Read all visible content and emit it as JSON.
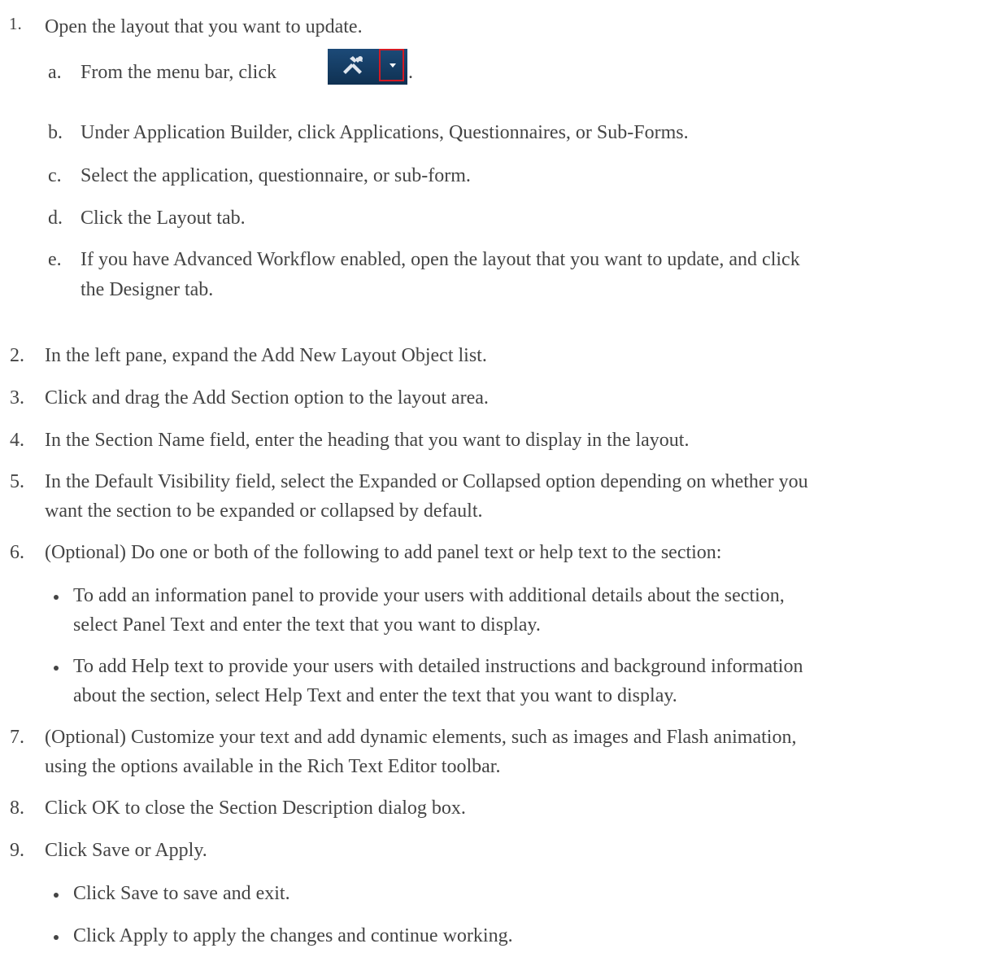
{
  "steps": {
    "s1": {
      "num": "1.",
      "text": "Open the layout that you want to update."
    },
    "s1a": {
      "letter": "a.",
      "text": "From the menu bar, click",
      "after": "."
    },
    "s1b": {
      "letter": "b.",
      "text": "Under Application Builder, click Applications, Questionnaires, or Sub-Forms."
    },
    "s1c": {
      "letter": "c.",
      "text": "Select the application, questionnaire, or sub-form."
    },
    "s1d": {
      "letter": "d.",
      "text": "Click the Layout tab."
    },
    "s1e": {
      "letter": "e.",
      "line1": "If you have Advanced Workflow enabled, open the layout that you want to update, and click",
      "line2": "the Designer tab."
    },
    "s2": {
      "num": "2.",
      "text": "In the left pane, expand the Add New Layout Object list."
    },
    "s3": {
      "num": "3.",
      "text": "Click and drag the Add Section option to the layout area."
    },
    "s4": {
      "num": "4.",
      "text": "In the Section Name field, enter the heading that you want to display in the layout."
    },
    "s5": {
      "num": "5.",
      "line1": "In the Default Visibility field, select the Expanded or Collapsed option depending on whether you",
      "line2": "want the section to be expanded or collapsed by default."
    },
    "s6": {
      "num": "6.",
      "text": "(Optional) Do one or both of the following to add panel text or help text to the section:"
    },
    "s6b1": {
      "line1": "To add an information panel to provide your users with additional details about the section,",
      "line2": "select Panel Text and enter the text that you want to display."
    },
    "s6b2": {
      "line1": "To add Help text to provide your users with detailed instructions and background information",
      "line2": "about the section, select Help Text and enter the text that you want to display."
    },
    "s7": {
      "num": "7.",
      "line1": "(Optional) Customize your text and add dynamic elements, such as images and Flash animation,",
      "line2": "using the options available in the Rich Text Editor toolbar."
    },
    "s8": {
      "num": "8.",
      "text": "Click OK to close the Section Description dialog box."
    },
    "s9": {
      "num": "9.",
      "text": "Click Save or Apply."
    },
    "s9b1": {
      "text": "Click Save to save and exit."
    },
    "s9b2": {
      "text": "Click Apply to apply the changes and continue working."
    }
  },
  "menu_button": {
    "icon": "tools-icon",
    "dropdown_icon": "chevron-down-icon",
    "highlight_color": "#d21a24",
    "background_color": "#12385e"
  }
}
